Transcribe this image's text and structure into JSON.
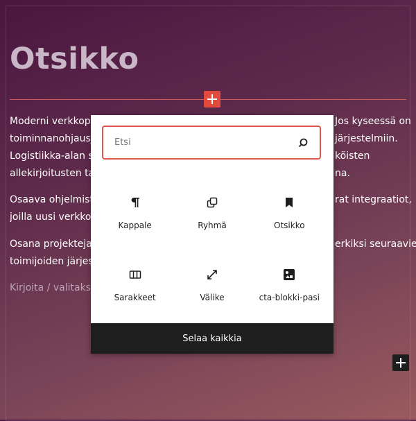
{
  "editor": {
    "heading": "Otsikko",
    "paragraphs": [
      [
        "Moderni verkkopa",
        "Jos kyseessä on"
      ],
      [
        "toiminnanohjausjä",
        "järjestelmiin."
      ],
      [
        "Logistiikka-alan so",
        "köisten"
      ],
      [
        "allekirjoitusten tar",
        "na."
      ]
    ],
    "paragraph2": [
      [
        "Osaava ohjelmisto",
        "rat integraatiot,"
      ],
      [
        "joilla uusi verkkop",
        ""
      ]
    ],
    "paragraph3": [
      [
        "Osana projektejar",
        "erkiksi seuraavien"
      ],
      [
        "toimijoiden järjest",
        ""
      ]
    ],
    "placeholder_line": "Kirjoita / valitakse"
  },
  "inserter": {
    "search_placeholder": "Etsi",
    "blocks": [
      {
        "label": "Kappale",
        "icon": "paragraph-icon"
      },
      {
        "label": "Ryhmä",
        "icon": "group-icon"
      },
      {
        "label": "Otsikko",
        "icon": "heading-bookmark-icon"
      },
      {
        "label": "Sarakkeet",
        "icon": "columns-icon"
      },
      {
        "label": "Välike",
        "icon": "spacer-resize-icon"
      },
      {
        "label": "cta-blokki-pasi",
        "icon": "reusable-block-icon"
      }
    ],
    "browse_all_label": "Selaa kaikkia"
  },
  "colors": {
    "accent": "#e04b3e",
    "dark": "#1e1e1e"
  }
}
